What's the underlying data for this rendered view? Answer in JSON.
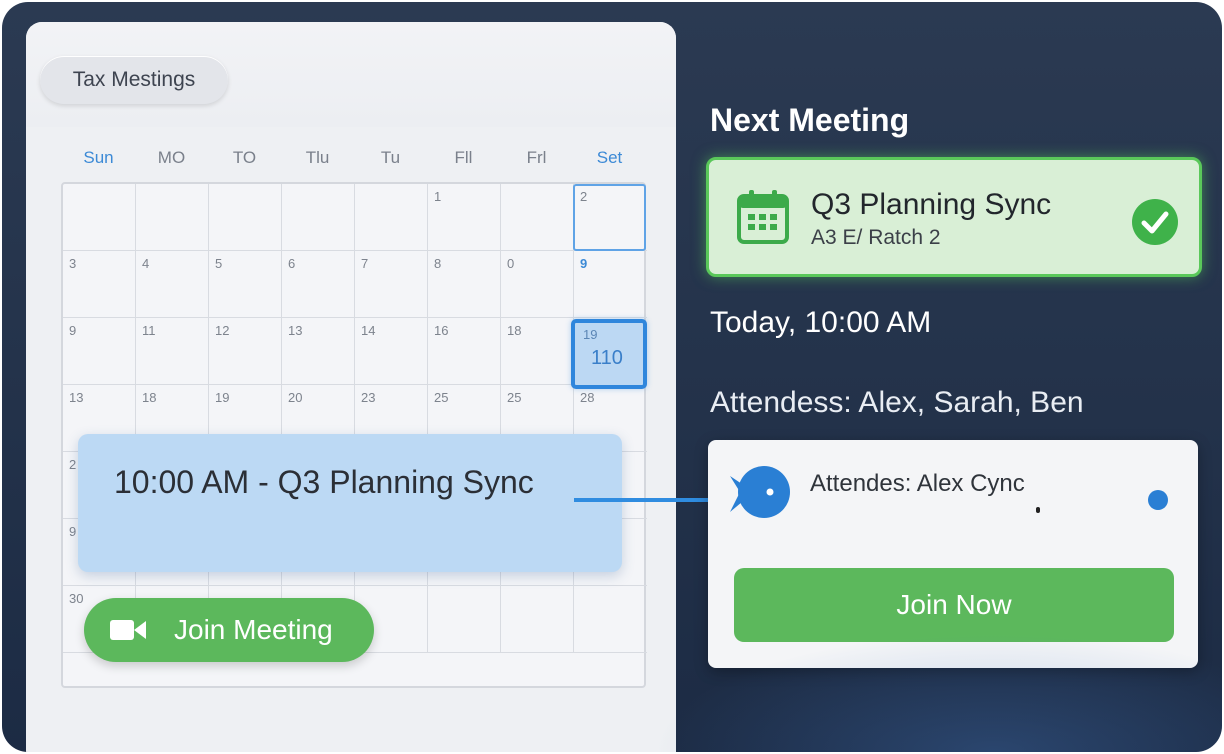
{
  "calendar": {
    "tab_label": "Tax Mestings",
    "days_of_week": [
      "Sun",
      "MO",
      "TO",
      "Tlu",
      "Tu",
      "Fll",
      "Frl",
      "Set"
    ],
    "weeks": [
      [
        "",
        "",
        "",
        "",
        "",
        "1",
        "",
        "2"
      ],
      [
        "3",
        "4",
        "5",
        "6",
        "7",
        "8",
        "0",
        "9"
      ],
      [
        "9",
        "11",
        "12",
        "13",
        "14",
        "16",
        "18",
        ""
      ],
      [
        "13",
        "18",
        "19",
        "20",
        "23",
        "25",
        "25",
        "28"
      ],
      [
        "2",
        "",
        "",
        "",
        "",
        "",
        "",
        ""
      ],
      [
        "9",
        "",
        "",
        "",
        "",
        "",
        "",
        ""
      ],
      [
        "30",
        "",
        "",
        "",
        "",
        "",
        "",
        ""
      ]
    ],
    "selected_day_top": "19",
    "selected_day_number": "110",
    "event_text": "10:00 AM - Q3 Planning Sync",
    "join_meeting_label": "Join Meeting"
  },
  "next_meeting": {
    "heading": "Next Meeting",
    "title": "Q3 Planning Sync",
    "subtitle": "A3 E/ Ratch 2",
    "time": "Today, 10:00 AM",
    "attendees": "Attendess: Alex, Sarah, Ben"
  },
  "attendee_card": {
    "text": "Attendes: Alex Cync",
    "join_now_label": "Join Now"
  },
  "colors": {
    "accent_blue": "#2f86dc",
    "success_green": "#5cb85c",
    "panel_bg": "#23324a"
  }
}
